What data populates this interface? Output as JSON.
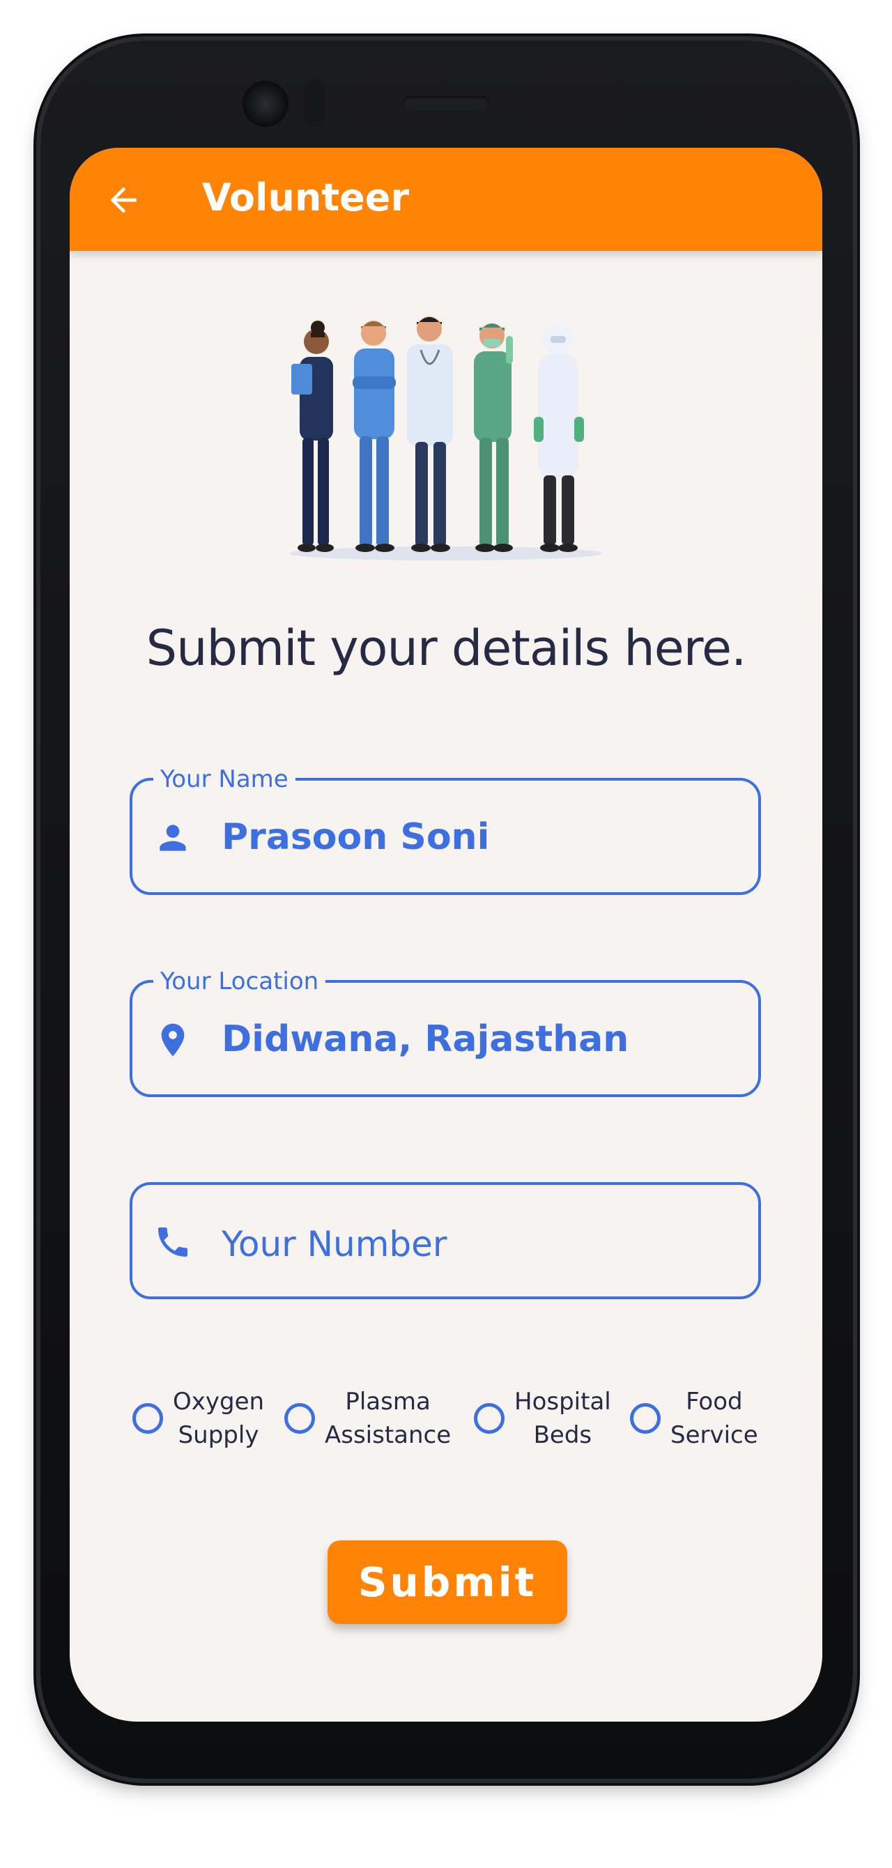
{
  "app_bar": {
    "title": "Volunteer",
    "back_icon": "arrow-left-icon"
  },
  "illustration": {
    "icon": "healthcare-workers-illustration"
  },
  "heading": "Submit your details here.",
  "form": {
    "name": {
      "label": "Your Name",
      "value": "Prasoon Soni",
      "icon": "person-icon"
    },
    "location": {
      "label": "Your Location",
      "value": "Didwana, Rajasthan",
      "icon": "location-pin-icon"
    },
    "number": {
      "placeholder": "Your Number",
      "value": "",
      "icon": "phone-icon"
    }
  },
  "options": [
    {
      "line1": "Oxygen",
      "line2": "Supply",
      "selected": false
    },
    {
      "line1": "Plasma",
      "line2": "Assistance",
      "selected": false
    },
    {
      "line1": "Hospital",
      "line2": "Beds",
      "selected": false
    },
    {
      "line1": "Food",
      "line2": "Service",
      "selected": false
    }
  ],
  "submit_label": "Submit",
  "colors": {
    "primary": "#ff8304",
    "accent": "#3d6fe0",
    "background": "#f6f3f0",
    "text_dark": "#262a44"
  }
}
